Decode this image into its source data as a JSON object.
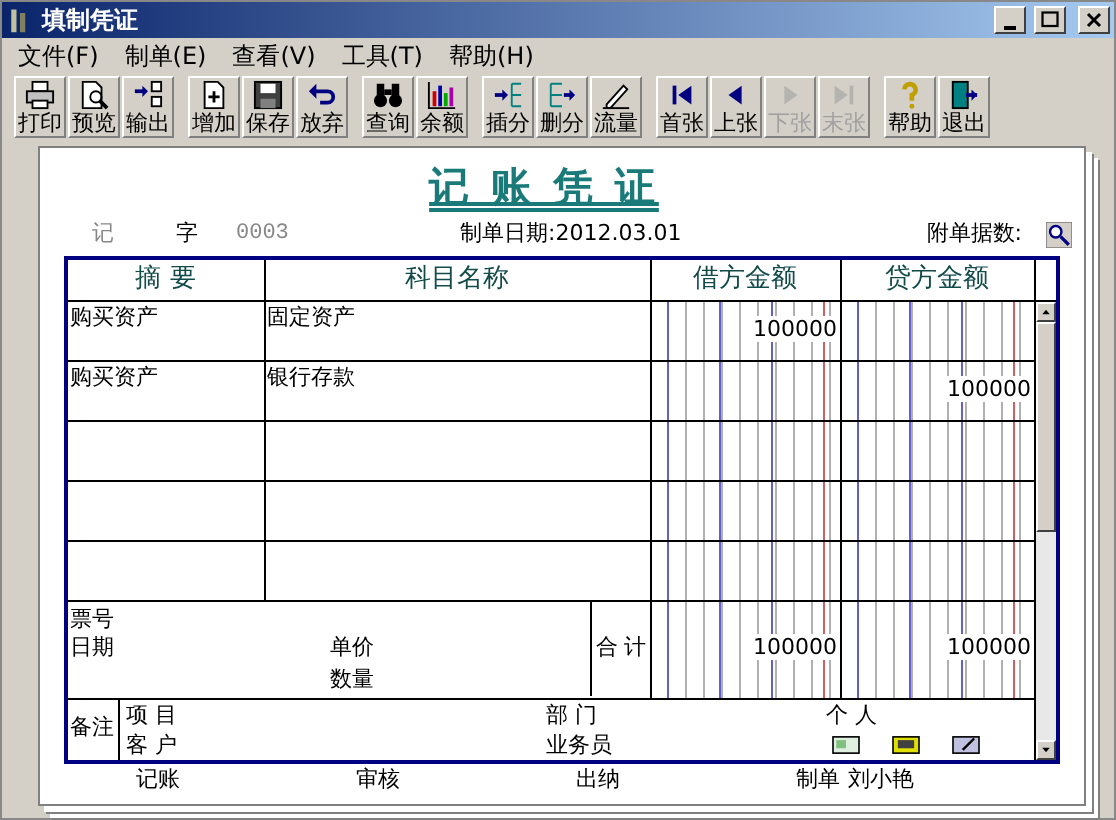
{
  "window": {
    "title": "填制凭证"
  },
  "menu": [
    {
      "label": "文件(F)"
    },
    {
      "label": "制单(E)"
    },
    {
      "label": "查看(V)"
    },
    {
      "label": "工具(T)"
    },
    {
      "label": "帮助(H)"
    }
  ],
  "toolbar": [
    [
      {
        "label": "打印",
        "disabled": false
      },
      {
        "label": "预览",
        "disabled": false
      },
      {
        "label": "输出",
        "disabled": false
      }
    ],
    [
      {
        "label": "增加",
        "disabled": false
      },
      {
        "label": "保存",
        "disabled": false
      },
      {
        "label": "放弃",
        "disabled": false
      }
    ],
    [
      {
        "label": "查询",
        "disabled": false
      },
      {
        "label": "余额",
        "disabled": false
      }
    ],
    [
      {
        "label": "插分",
        "disabled": false
      },
      {
        "label": "删分",
        "disabled": false
      },
      {
        "label": "流量",
        "disabled": false
      }
    ],
    [
      {
        "label": "首张",
        "disabled": false
      },
      {
        "label": "上张",
        "disabled": false
      },
      {
        "label": "下张",
        "disabled": true
      },
      {
        "label": "末张",
        "disabled": true
      }
    ],
    [
      {
        "label": "帮助",
        "disabled": false
      },
      {
        "label": "退出",
        "disabled": false
      }
    ]
  ],
  "voucher": {
    "title": "记 账 凭 证",
    "type": "记",
    "word": "字",
    "number": "0003",
    "date_label": "制单日期:",
    "date": "2012.03.01",
    "attachments_label": "附单据数:"
  },
  "columns": [
    "摘 要",
    "科目名称",
    "借方金额",
    "贷方金额"
  ],
  "rows": [
    {
      "summary": "购买资产",
      "account": "固定资产",
      "debit": "100000",
      "credit": ""
    },
    {
      "summary": "购买资产",
      "account": "银行存款",
      "debit": "",
      "credit": "100000"
    },
    {
      "summary": "",
      "account": "",
      "debit": "",
      "credit": ""
    },
    {
      "summary": "",
      "account": "",
      "debit": "",
      "credit": ""
    },
    {
      "summary": "",
      "account": "",
      "debit": "",
      "credit": ""
    }
  ],
  "totals": {
    "ticket_label": "票号",
    "date_label": "日期",
    "price_label": "单价",
    "quantity_label": "数量",
    "total_label": "合 计",
    "debit_total": "100000",
    "credit_total": "100000"
  },
  "remarks": {
    "label": "备注",
    "project_label": "项 目",
    "customer_label": "客 户",
    "department_label": "部 门",
    "salesperson_label": "业务员",
    "person_label": "个 人"
  },
  "signatures": [
    {
      "label": "记账"
    },
    {
      "label": "审核"
    },
    {
      "label": "出纳"
    },
    {
      "label": "制单",
      "value": "刘小艳"
    }
  ]
}
